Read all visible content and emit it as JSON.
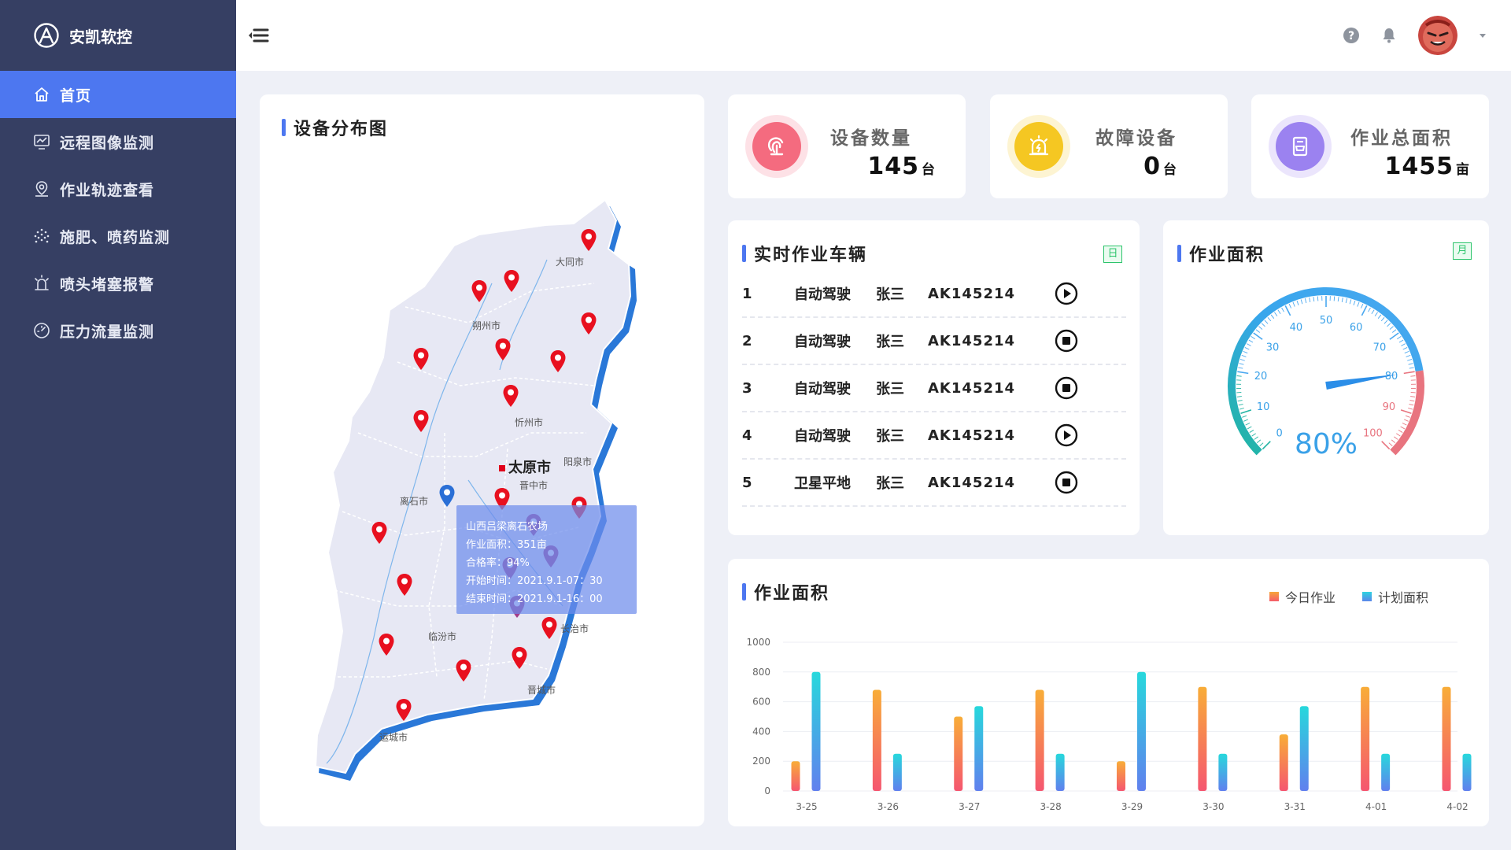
{
  "brand": {
    "name": "安凯软控"
  },
  "sidebar": {
    "items": [
      {
        "label": "首页",
        "icon": "home-icon",
        "active": true
      },
      {
        "label": "远程图像监测",
        "icon": "monitor-icon",
        "active": false
      },
      {
        "label": "作业轨迹查看",
        "icon": "location-icon",
        "active": false
      },
      {
        "label": "施肥、喷药监测",
        "icon": "spray-icon",
        "active": false
      },
      {
        "label": "喷头堵塞报警",
        "icon": "alarm-icon",
        "active": false
      },
      {
        "label": "压力流量监测",
        "icon": "gauge-icon",
        "active": false
      }
    ]
  },
  "header": {
    "help_icon": "help-icon",
    "bell_icon": "bell-icon"
  },
  "map_panel": {
    "title": "设备分布图",
    "capital": "太原市",
    "city_labels": [
      "大同市",
      "朔州市",
      "忻州市",
      "阳泉市",
      "晋中市",
      "离石市",
      "临汾市",
      "长治市",
      "晋城市",
      "运城市"
    ],
    "tooltip": {
      "name": "山西吕梁离石农场",
      "area": "作业面积：351亩",
      "rate": "合格率：94%",
      "start": "开始时间：2021.9.1-07：30",
      "end": "结束时间：2021.9.1-16：00"
    }
  },
  "stats": [
    {
      "label": "设备数量",
      "value": "145",
      "unit": "台",
      "icon": "device-icon",
      "color": "#f46b7f"
    },
    {
      "label": "故障设备",
      "value": "0",
      "unit": "台",
      "icon": "warning-icon",
      "color": "#f5c722"
    },
    {
      "label": "作业总面积",
      "value": "1455",
      "unit": "亩",
      "icon": "area-icon",
      "color": "#9b82f0"
    }
  ],
  "vehicles_panel": {
    "title": "实时作业车辆",
    "badge": "日",
    "rows": [
      {
        "idx": "1",
        "mode": "自动驾驶",
        "name": "张三",
        "plate": "AK145214",
        "action": "play"
      },
      {
        "idx": "2",
        "mode": "自动驾驶",
        "name": "张三",
        "plate": "AK145214",
        "action": "stop"
      },
      {
        "idx": "3",
        "mode": "自动驾驶",
        "name": "张三",
        "plate": "AK145214",
        "action": "stop"
      },
      {
        "idx": "4",
        "mode": "自动驾驶",
        "name": "张三",
        "plate": "AK145214",
        "action": "play"
      },
      {
        "idx": "5",
        "mode": "卫星平地",
        "name": "张三",
        "plate": "AK145214",
        "action": "stop"
      }
    ]
  },
  "gauge_panel": {
    "title": "作业面积",
    "badge": "月",
    "value": 80,
    "value_label": "80%",
    "min": 0,
    "max": 100,
    "ticks": [
      "0",
      "10",
      "20",
      "30",
      "40",
      "50",
      "60",
      "70",
      "80",
      "90",
      "100"
    ]
  },
  "chart_panel": {
    "title": "作业面积",
    "colors": {
      "today": "#f7a63a",
      "plan": "#2ed3e0"
    }
  },
  "chart_data": {
    "type": "bar",
    "categories": [
      "3-25",
      "3-26",
      "3-27",
      "3-28",
      "3-29",
      "3-30",
      "3-31",
      "4-01",
      "4-02"
    ],
    "series": [
      {
        "name": "今日作业",
        "values": [
          200,
          680,
          500,
          680,
          200,
          700,
          380,
          700,
          700
        ]
      },
      {
        "name": "计划面积",
        "values": [
          800,
          250,
          570,
          250,
          800,
          250,
          570,
          250,
          250
        ]
      }
    ],
    "ylim": [
      0,
      1000
    ],
    "yticks": [
      "1000",
      "800",
      "600",
      "400",
      "200",
      "0"
    ],
    "legend_position": "top-right",
    "grid": true
  }
}
